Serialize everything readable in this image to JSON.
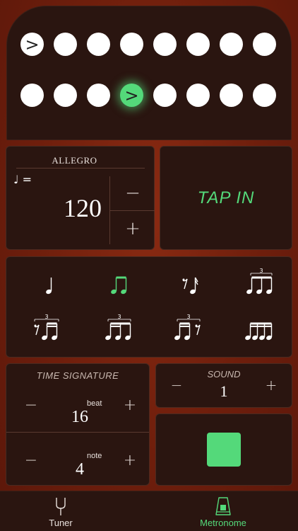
{
  "beats": {
    "accent_symbol": ">",
    "accents": [
      true,
      false,
      false,
      false,
      false,
      false,
      false,
      false,
      false,
      false,
      false,
      true,
      false,
      false,
      false,
      false
    ],
    "active_index": 11
  },
  "tempo": {
    "marking": "ALLEGRO",
    "note_symbol": "♩ =",
    "bpm": "120",
    "decrease": "−",
    "increase": "+"
  },
  "tap": {
    "label": "TAP IN"
  },
  "subdivisions": {
    "options": [
      "quarter",
      "eighths",
      "rest-sixteenth",
      "triplet-eighths",
      "triplet-rest-sixteenths",
      "triplet-sixteenth-eighth",
      "triplet-sixteenths-rest",
      "sixteenths"
    ],
    "selected": 1
  },
  "time_signature": {
    "title": "TIME SIGNATURE",
    "beat_label": "beat",
    "beat_value": "16",
    "note_label": "note",
    "note_value": "4",
    "minus": "−",
    "plus": "+"
  },
  "sound": {
    "title": "SOUND",
    "value": "1",
    "minus": "−",
    "plus": "+"
  },
  "tabs": [
    {
      "label": "Tuner",
      "icon": "tuning-fork-icon",
      "active": false
    },
    {
      "label": "Metronome",
      "icon": "metronome-icon",
      "active": true
    }
  ],
  "colors": {
    "accent": "#54d97a",
    "panel": "#2a1510",
    "background": "#6e1e0c"
  }
}
